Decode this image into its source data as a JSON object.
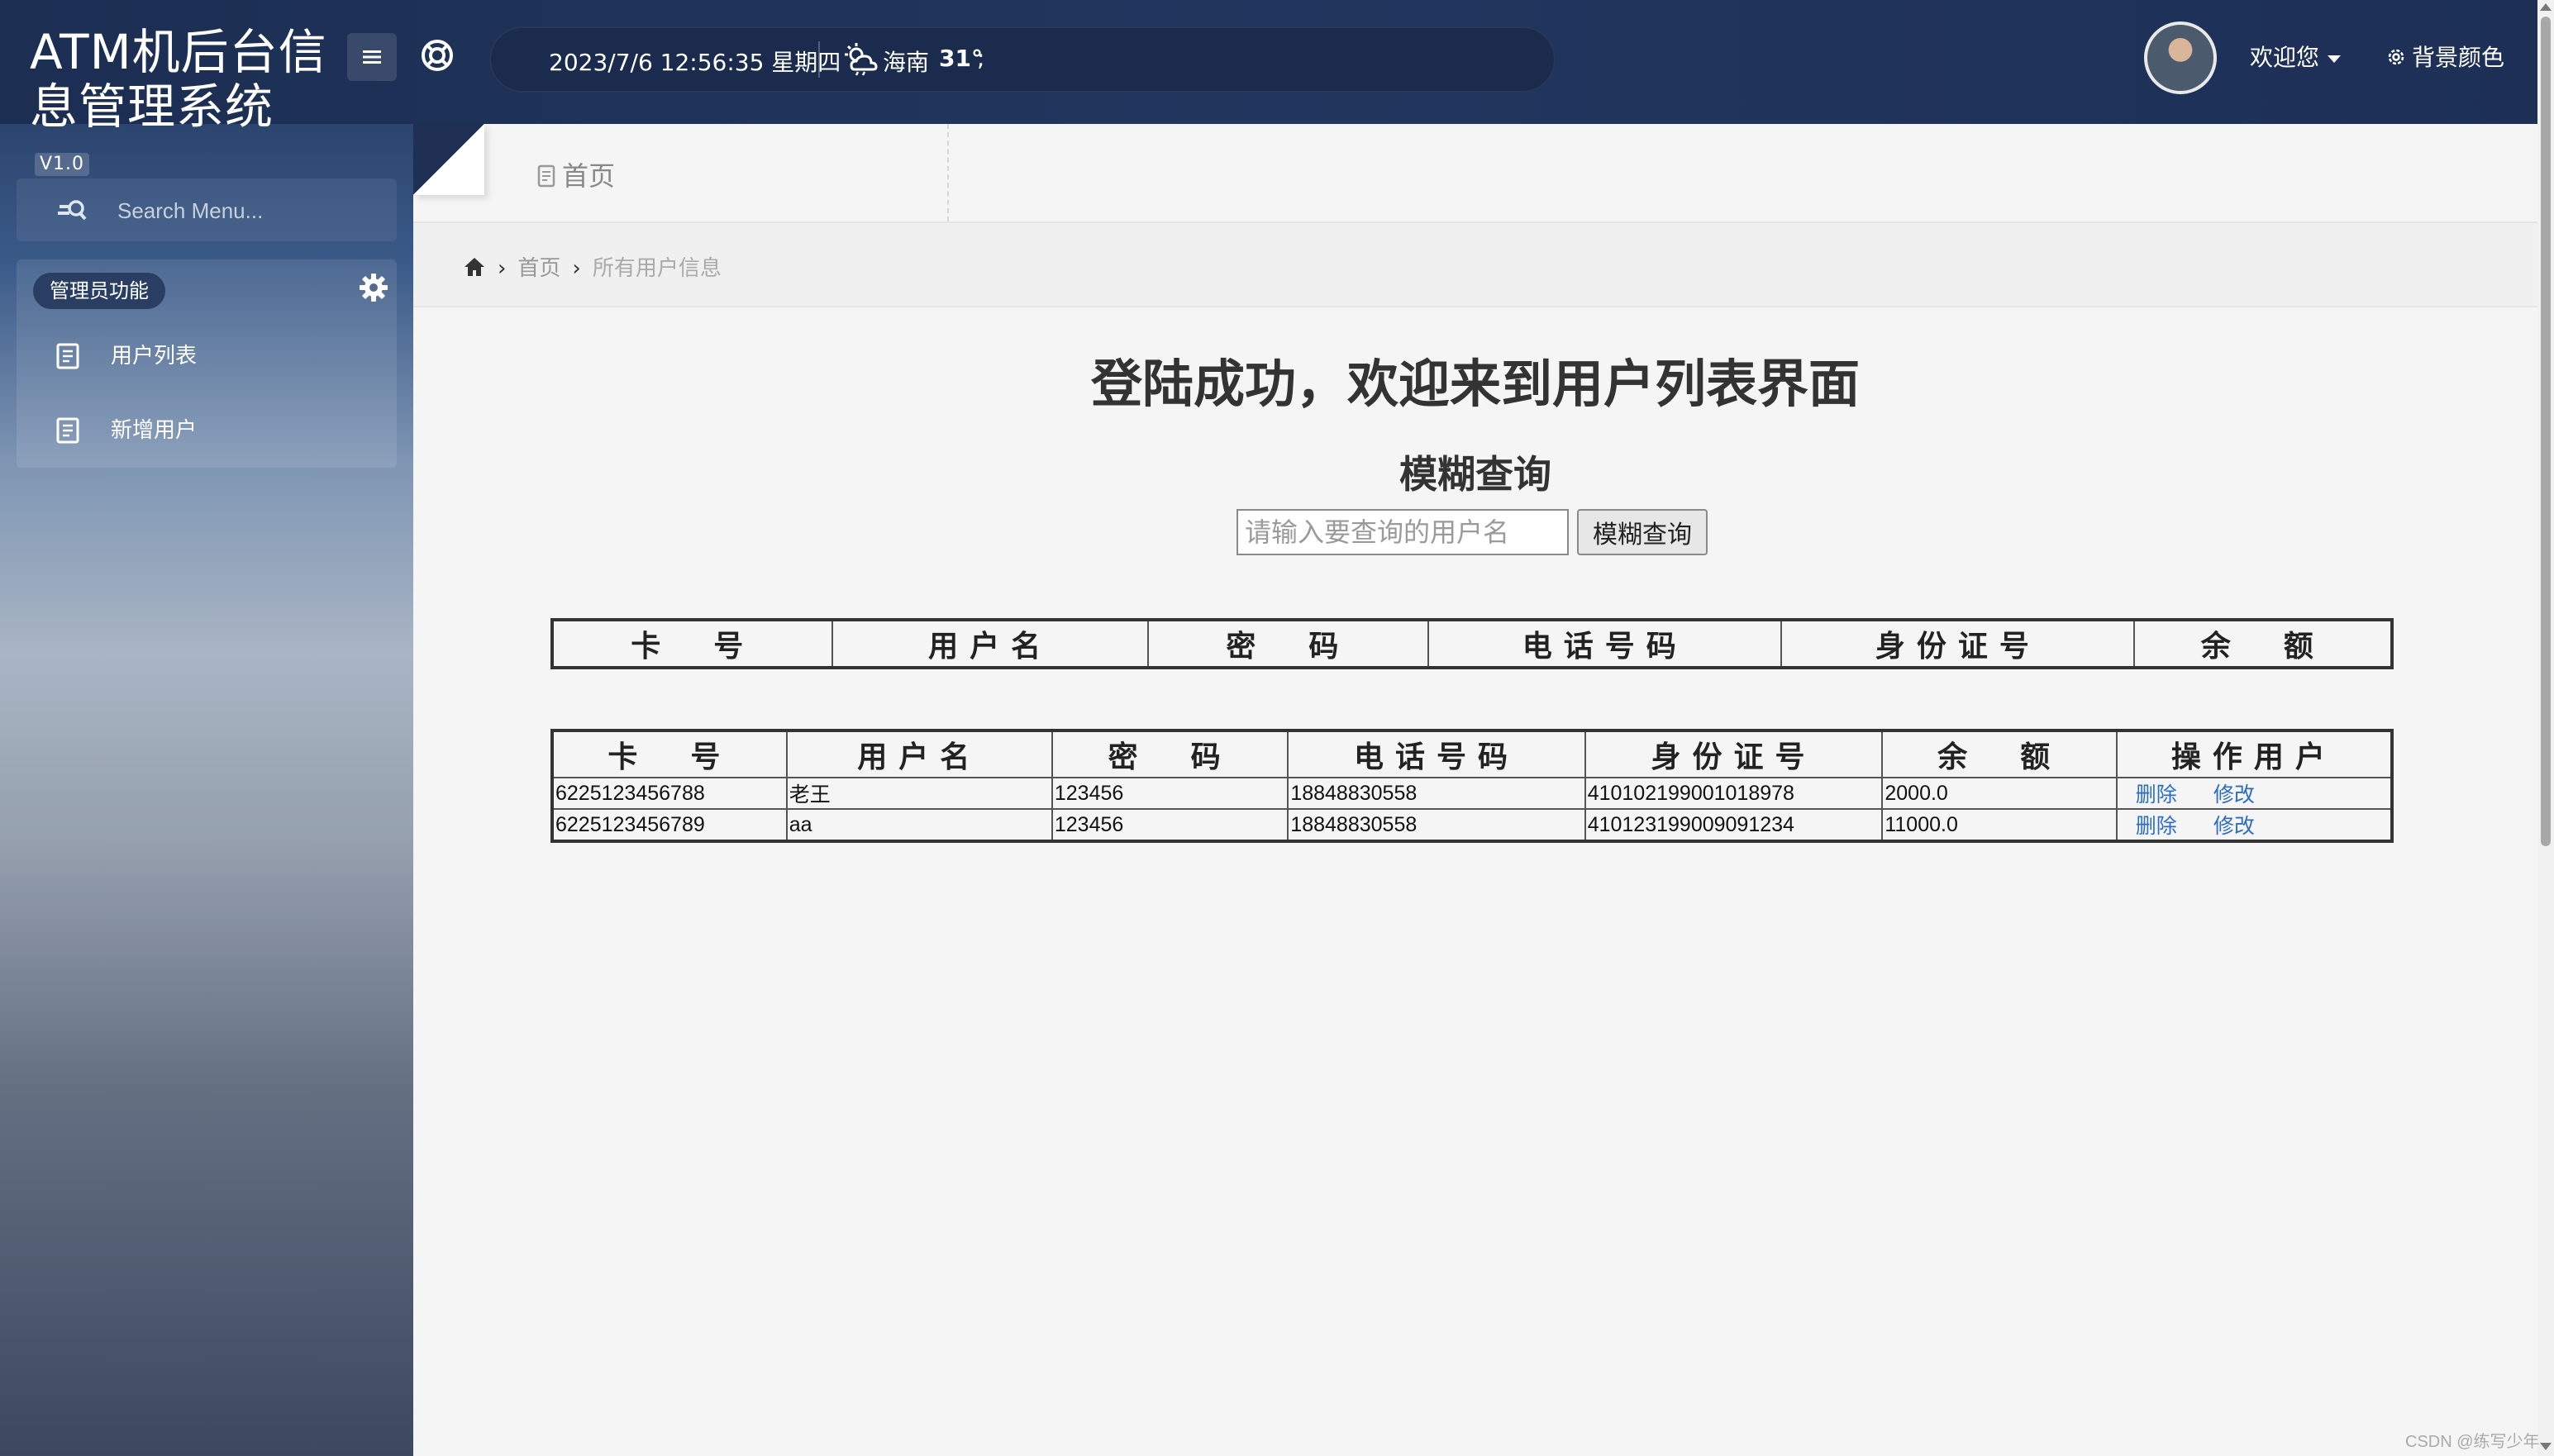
{
  "header": {
    "app_title": "ATM机后台信息管理系统",
    "version": "V1.0",
    "datetime": "2023/7/6 12:56:35 星期四",
    "city": "海南",
    "temperature": "31°",
    "temp_suffix": ";",
    "welcome": "欢迎您",
    "bg_color": "背景颜色",
    "icons": {
      "menu_toggle": "hamburger-icon",
      "help": "lifebuoy-icon",
      "weather": "cloud-sun-icon",
      "settings": "gear-icon"
    }
  },
  "sidebar": {
    "search_placeholder": "Search Menu...",
    "group_label": "管理员功能",
    "items": [
      {
        "label": "用户列表",
        "icon": "document-icon"
      },
      {
        "label": "新增用户",
        "icon": "document-icon"
      }
    ]
  },
  "tabs": [
    {
      "label": "首页",
      "icon": "document-icon"
    }
  ],
  "breadcrumb": {
    "home_icon": "home-icon",
    "items": [
      "首页",
      "所有用户信息"
    ]
  },
  "main": {
    "title": "登陆成功，欢迎来到用户列表界面",
    "query_title": "模糊查询",
    "query_placeholder": "请输入要查询的用户名",
    "query_button": "模糊查询"
  },
  "table_header_only": {
    "columns": [
      "卡　号",
      "用户名",
      "密　码",
      "电话号码",
      "身份证号",
      "余　额"
    ]
  },
  "table_users": {
    "columns": [
      "卡　号",
      "用户名",
      "密　码",
      "电话号码",
      "身份证号",
      "余　额",
      "操作用户"
    ],
    "rows": [
      {
        "card": "6225123456788",
        "name": "老王",
        "password": "123456",
        "phone": "18848830558",
        "id_no": "410102199001018978",
        "balance": "2000.0",
        "delete": "删除",
        "edit": "修改"
      },
      {
        "card": "6225123456789",
        "name": "aa",
        "password": "123456",
        "phone": "18848830558",
        "id_no": "410123199009091234",
        "balance": "11000.0",
        "delete": "删除",
        "edit": "修改"
      }
    ]
  },
  "footer": {
    "watermark": "CSDN @练写少年"
  },
  "colors": {
    "header_bg": "#22365f",
    "link": "#2b6cc4",
    "content_bg": "#f5f5f5"
  }
}
